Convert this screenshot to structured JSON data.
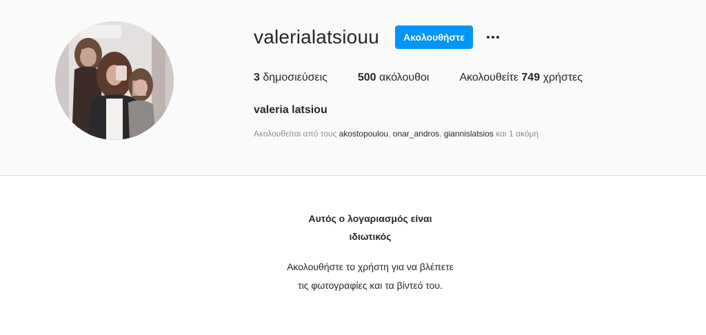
{
  "profile": {
    "username": "valerialatsiouu",
    "follow_label": "Ακολουθήστε",
    "more_icon": "more-options-icon",
    "full_name": "valeria latsiou",
    "stats": {
      "posts_count": "3",
      "posts_label": "δημοσιεύσεις",
      "followers_count": "500",
      "followers_label": "ακόλουθοι",
      "following_prefix": "Ακολουθείτε",
      "following_count": "749",
      "following_suffix": "χρήστες"
    },
    "followed_by": {
      "prefix": "Ακολουθείται από τους",
      "accounts": [
        "akostopoulou",
        "onar_andros",
        "giannislatsios"
      ],
      "suffix": "και 1 ακόμη"
    }
  },
  "private_notice": {
    "title": "Αυτός ο λογαριασμός είναι ιδιωτικός",
    "text": "Ακολουθήστε το χρήστη για να βλέπετε τις φωτογραφίες και τα βίντεό του."
  },
  "colors": {
    "follow_button": "#0095f6",
    "header_background": "#fafafa",
    "muted_text": "#8e8e8e"
  }
}
